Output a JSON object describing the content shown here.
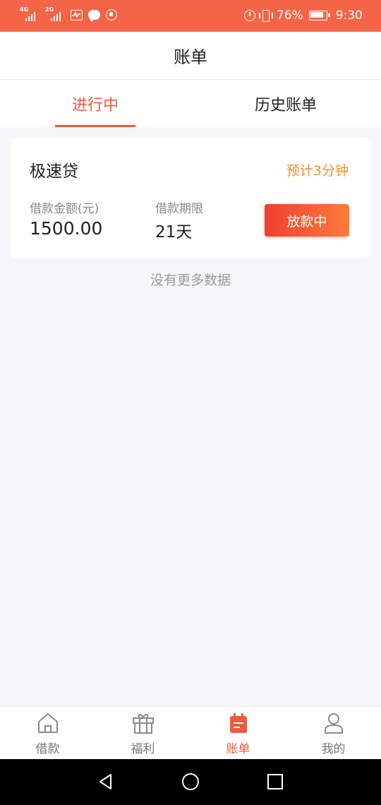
{
  "status_bar": {
    "signal1_tag": "4G",
    "signal2_tag": "2G",
    "battery_percent": "76%",
    "time": "9:30",
    "battery_level": 0.76
  },
  "header": {
    "title": "账单"
  },
  "tabs": [
    {
      "label": "进行中",
      "active": true
    },
    {
      "label": "历史账单",
      "active": false
    }
  ],
  "loan_card": {
    "product_name": "极速贷",
    "eta": "预计3分钟",
    "amount_label": "借款金额(元)",
    "amount_value": "1500.00",
    "term_label": "借款期限",
    "term_value": "21天",
    "status_button": "放款中"
  },
  "list_footer": "没有更多数据",
  "bottom_nav": [
    {
      "label": "借款",
      "icon": "home-icon",
      "active": false
    },
    {
      "label": "福利",
      "icon": "gift-icon",
      "active": false
    },
    {
      "label": "账单",
      "icon": "bill-icon",
      "active": true
    },
    {
      "label": "我的",
      "icon": "user-icon",
      "active": false
    }
  ],
  "colors": {
    "status_bar": "#f46447",
    "accent": "#f05a3e",
    "eta_orange": "#f0912c",
    "background": "#f6f6fa"
  }
}
